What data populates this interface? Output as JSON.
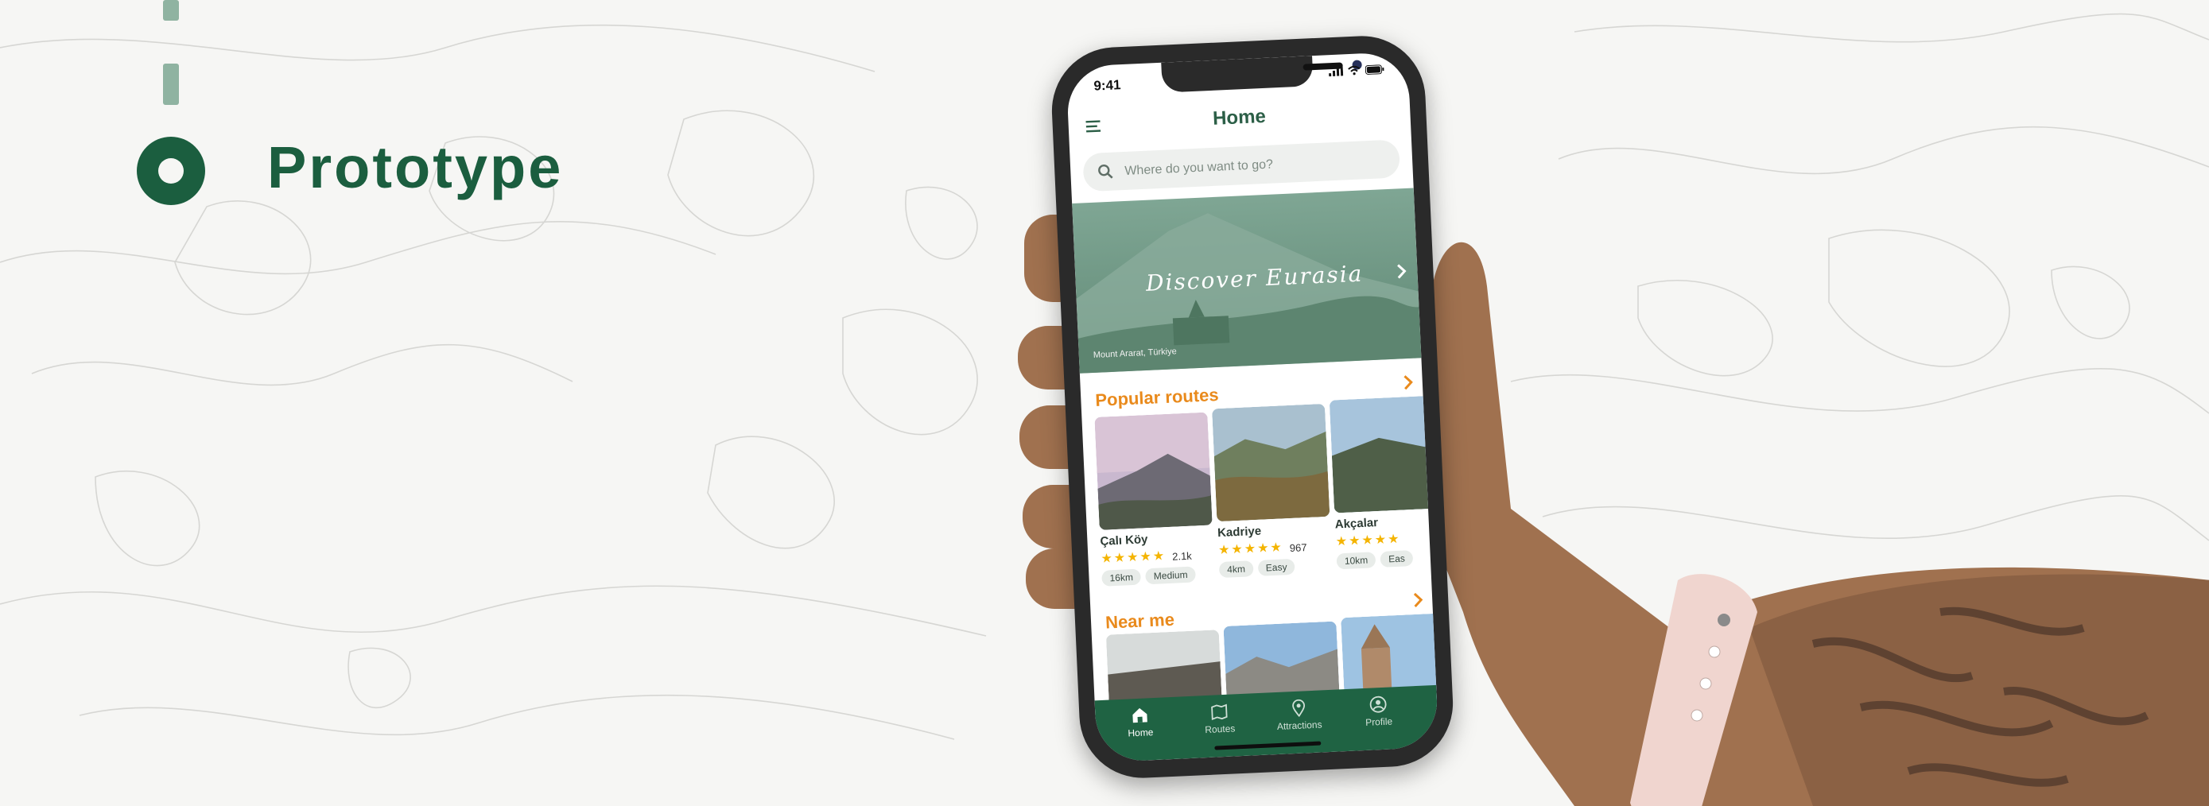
{
  "slide": {
    "heading": "Prototype"
  },
  "colors": {
    "brand_green": "#1b5e3f",
    "accent_orange": "#e98a1c",
    "background": "#f6f6f4"
  },
  "app": {
    "status_time": "9:41",
    "title": "Home",
    "search_placeholder": "Where do you want to go?",
    "hero": {
      "title": "Discover Eurasia",
      "caption": "Mount Ararat, Türkiye"
    },
    "popular": {
      "title": "Popular routes",
      "routes": [
        {
          "name": "Çalı Köy",
          "rating": 5,
          "count": "2.1k",
          "distance": "16km",
          "difficulty": "Medium"
        },
        {
          "name": "Kadriye",
          "rating": 5,
          "count": "967",
          "distance": "4km",
          "difficulty": "Easy"
        },
        {
          "name": "Akçalar",
          "rating": 5,
          "count": "",
          "distance": "10km",
          "difficulty": "Eas"
        }
      ]
    },
    "near": {
      "title": "Near me"
    },
    "tabs": [
      {
        "label": "Home",
        "icon": "home-icon"
      },
      {
        "label": "Routes",
        "icon": "map-icon"
      },
      {
        "label": "Attractions",
        "icon": "pin-icon"
      },
      {
        "label": "Profile",
        "icon": "user-icon"
      }
    ]
  }
}
